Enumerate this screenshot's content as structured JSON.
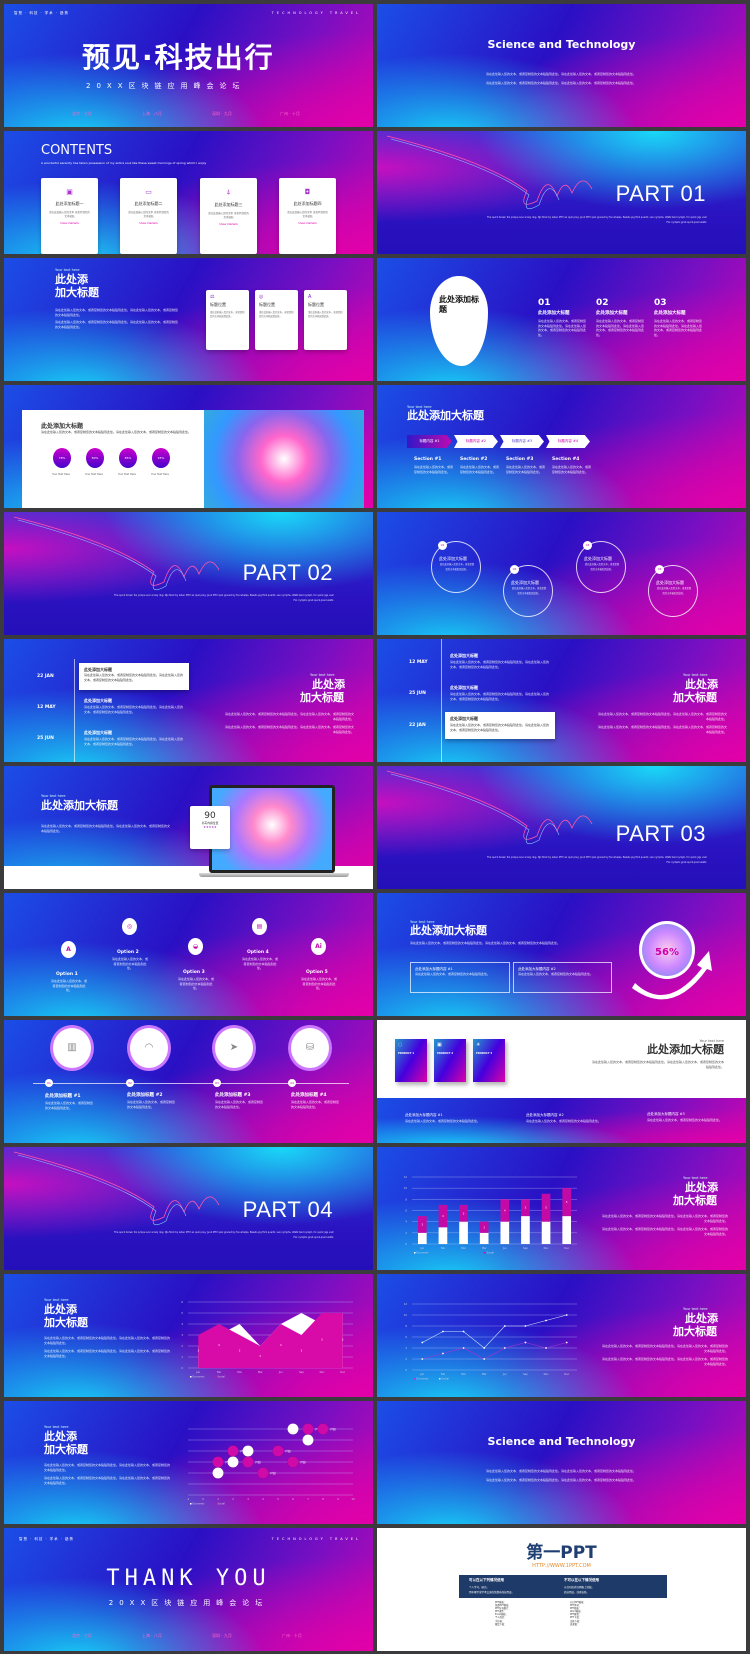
{
  "common": {
    "body": "请在此处输入您的文本，或者复制您的文本粘贴到此处。请在此处输入您的文本，或者复制您的文本粘贴到此处。",
    "short": "请在此处输入您的文本，或者复制您的文本粘贴到此处。",
    "your_text": "Your text here",
    "title_a": "此处添",
    "title_b": "加大标题",
    "big_title": "此处添加大标题",
    "caption": "The quick brown fox jumps over a lazy dog. DJs flock by when MTV ax quiz prog. Junk MTV quiz graced by fox whelps. Bawds jog flick quartz, vex nymphs. Waltz bad nymph, for quick jigs vex! Fox nymphs grab quick-jived waltz."
  },
  "colors": {
    "cyan": "#17d6f7",
    "blue": "#2a10c4",
    "magenta": "#e000a8"
  },
  "cover": {
    "tags": "智慧 · 科技 · 学术 · 趋势",
    "brand": "TECHNOLOGY TRAVEL",
    "title": "预见·科技出行",
    "subtitle": "20XX区块链应用峰会论坛",
    "cities": [
      "北京 · 七月",
      "上海 · 八月",
      "深圳 · 九月",
      "广州 · 十月"
    ]
  },
  "intro": {
    "title": "Science and Technology",
    "watermark": "Science and Technology"
  },
  "contents": {
    "title": "CONTENTS",
    "subtitle": "A wonderful serenity has taken possession of my entire soul like these sweet mornings of spring which I enjoy",
    "cards": [
      {
        "title": "此处添加标题一",
        "icon": "tablet-icon"
      },
      {
        "title": "此处添加标题二",
        "icon": "monitor-icon"
      },
      {
        "title": "此处添加标题三",
        "icon": "antenna-icon"
      },
      {
        "title": "此处添加标题四",
        "icon": "bag-icon"
      }
    ],
    "card_body": "请在此处输入您的文本 或者复制您的文本粘贴",
    "link": "View Details"
  },
  "parts": [
    "PART 01",
    "PART 02",
    "PART 03",
    "PART 04"
  ],
  "slide5": {
    "cards": [
      {
        "title": "标题位置",
        "icon": "scale-icon"
      },
      {
        "title": "标题位置",
        "icon": "24h-icon"
      },
      {
        "title": "标题位置",
        "icon": "text-icon"
      }
    ]
  },
  "slide6": {
    "blob": "此处添加标题",
    "cols": [
      {
        "num": "01",
        "title": "此处添加大标题"
      },
      {
        "num": "02",
        "title": "此处添加大标题"
      },
      {
        "num": "03",
        "title": "此处添加大标题"
      }
    ]
  },
  "slide7": {
    "title": "此处添加大标题",
    "stats": [
      {
        "value": "78%",
        "label": "Your Text Here"
      },
      {
        "value": "80%",
        "label": "Your Text Here"
      },
      {
        "value": "85%",
        "label": "Your Text Here"
      },
      {
        "value": "95%",
        "label": "Your Text Here"
      }
    ]
  },
  "slide8": {
    "chevrons": [
      "标题内容 #1",
      "标题内容 #2",
      "标题内容 #3",
      "标题内容 #4"
    ],
    "sections": [
      "Section #1",
      "Section #2",
      "Section #3",
      "Section #4"
    ]
  },
  "slide10": {
    "items": [
      {
        "num": "01",
        "title": "此处添加大标题"
      },
      {
        "num": "02",
        "title": "此处添加大标题"
      },
      {
        "num": "03",
        "title": "此处添加大标题"
      },
      {
        "num": "04",
        "title": "此处添加大标题"
      }
    ]
  },
  "timeline1": {
    "dates": [
      "22 JAN",
      "12 MAY",
      "25 JUN"
    ],
    "title": "此处添加大标题"
  },
  "timeline2": {
    "dates": [
      "12 MAY",
      "25 JUN",
      "22 JAN"
    ],
    "title": "此处添加大标题"
  },
  "slide13": {
    "stat": "90",
    "stat_label": "书写内容位置",
    "stars": "★★★★★"
  },
  "slide15": {
    "options": [
      {
        "label": "Option 1",
        "icon": "text-icon"
      },
      {
        "label": "Option 2",
        "icon": "24h-icon"
      },
      {
        "label": "Option 3",
        "icon": "gamepad-icon"
      },
      {
        "label": "Option 4",
        "icon": "browser-icon"
      },
      {
        "label": "Option 5",
        "icon": "ai-icon"
      }
    ]
  },
  "slide16": {
    "percent": "56%",
    "percent_value": 56,
    "boxes": [
      "此处添加大标题内容 #1",
      "此处添加大标题内容 #2"
    ]
  },
  "slide17": {
    "items": [
      {
        "num": "01",
        "title": "此处添加标题 #1",
        "icon": "bar-chart-icon"
      },
      {
        "num": "02",
        "title": "此处添加标题 #2",
        "icon": "headset-icon"
      },
      {
        "num": "03",
        "title": "此处添加标题 #3",
        "icon": "cursor-icon"
      },
      {
        "num": "04",
        "title": "此处添加标题 #4",
        "icon": "database-icon"
      }
    ]
  },
  "slide18": {
    "products": [
      {
        "label": "PRODUCT 1",
        "icon": "chat-icon"
      },
      {
        "label": "PRODUCT 2",
        "icon": "board-icon"
      },
      {
        "label": "PRODUCT 3",
        "icon": "sun-icon"
      }
    ],
    "bottom": [
      "此处添加大标题内容 #1",
      "此处添加大标题内容 #2",
      "此处添加大标题内容 #3"
    ]
  },
  "thanks": {
    "title": "THANK YOU"
  },
  "credits": {
    "logo": "第一PPT",
    "url": "HTTP://WWW.1PPT.COM",
    "can_title": "可以在以下列情况使用",
    "cannot_title": "不可以在以下情况使用",
    "can": [
      "个人学习、研究。",
      "用于教学或学术交流的免费非商业用途。"
    ],
    "cannot": [
      "以任何形式在网络上转载。",
      "商业用途，或者出售。"
    ],
    "links_left": [
      "PPT模板：",
      "免费PPT模板：",
      "PPT背景图片：",
      "PPT课件：",
      "Excel模板：",
      "个人简历：",
      "手抄报：",
      "教案下载："
    ],
    "links_right": [
      "节日PPT模板：",
      "PPT素材：",
      "PPT图表：",
      "Word模板：",
      "PPT教程：",
      "PPT下载：",
      "试卷下载：",
      "说课稿："
    ]
  },
  "chart_data": [
    {
      "type": "bar",
      "stacked": true,
      "categories": [
        "Jan",
        "Feb",
        "Mar",
        "Mar",
        "Jun",
        "Sep",
        "Nov",
        "Dec"
      ],
      "series": [
        {
          "name": "Economic",
          "color": "#ffffff",
          "values": [
            2,
            3,
            4,
            2,
            4,
            5,
            4,
            5
          ]
        },
        {
          "name": "Social",
          "color": "#c40aa6",
          "values": [
            3,
            4,
            3,
            2,
            4,
            3,
            5,
            5
          ]
        }
      ],
      "ylim": [
        0,
        12
      ],
      "yticks": [
        0,
        2,
        4,
        6,
        8,
        10,
        12
      ],
      "grid": true,
      "legend": "bottom",
      "data_labels": "Social"
    },
    {
      "type": "area",
      "categories": [
        "Jan",
        "Feb",
        "Mar",
        "Mar",
        "Jun",
        "Sep",
        "Nov",
        "Dec"
      ],
      "series": [
        {
          "name": "Economic",
          "color": "#ffffff",
          "values": [
            2,
            3,
            4,
            2,
            4,
            5,
            4,
            5
          ]
        },
        {
          "name": "Social",
          "color": "#d80aa8",
          "values": [
            3,
            4,
            3,
            2,
            4,
            3,
            5,
            5
          ]
        }
      ],
      "ylim": [
        0,
        6
      ],
      "yticks": [
        0,
        1,
        2,
        3,
        4,
        5,
        6
      ],
      "grid": true,
      "legend": "bottom"
    },
    {
      "type": "line",
      "categories": [
        "Jan",
        "Feb",
        "Mar",
        "Mar",
        "Jun",
        "Sep",
        "Nov",
        "Dec"
      ],
      "series": [
        {
          "name": "Economic",
          "color": "#b030d0",
          "values": [
            2,
            3,
            4,
            2,
            4,
            5,
            4,
            5
          ]
        },
        {
          "name": "Social",
          "color": "#cfe8ff",
          "values": [
            5,
            7,
            7,
            4,
            8,
            8,
            9,
            10
          ]
        }
      ],
      "ylim": [
        0,
        12
      ],
      "yticks": [
        0,
        2,
        4,
        6,
        8,
        10,
        12
      ],
      "grid": true,
      "legend": "bottom"
    },
    {
      "type": "scatter",
      "series": [
        {
          "name": "Economic",
          "color": "#ffffff",
          "points": [
            [
              1,
              2
            ],
            [
              2,
              3
            ],
            [
              3,
              4
            ],
            [
              6,
              6
            ],
            [
              7,
              5
            ]
          ]
        },
        {
          "name": "Social",
          "color": "#d00aa8",
          "points": [
            [
              1,
              3
            ],
            [
              2,
              4
            ],
            [
              3,
              3
            ],
            [
              4,
              2
            ],
            [
              5,
              4
            ],
            [
              6,
              3
            ],
            [
              7,
              6
            ],
            [
              8,
              6
            ]
          ]
        }
      ],
      "xlim": [
        -1,
        10
      ],
      "xticks": [
        -1,
        0,
        1,
        2,
        3,
        4,
        5,
        6,
        7,
        8,
        9,
        10
      ],
      "ylim": [
        0,
        6
      ],
      "grid": true,
      "legend": "bottom",
      "point_label": "(Y值)"
    }
  ]
}
